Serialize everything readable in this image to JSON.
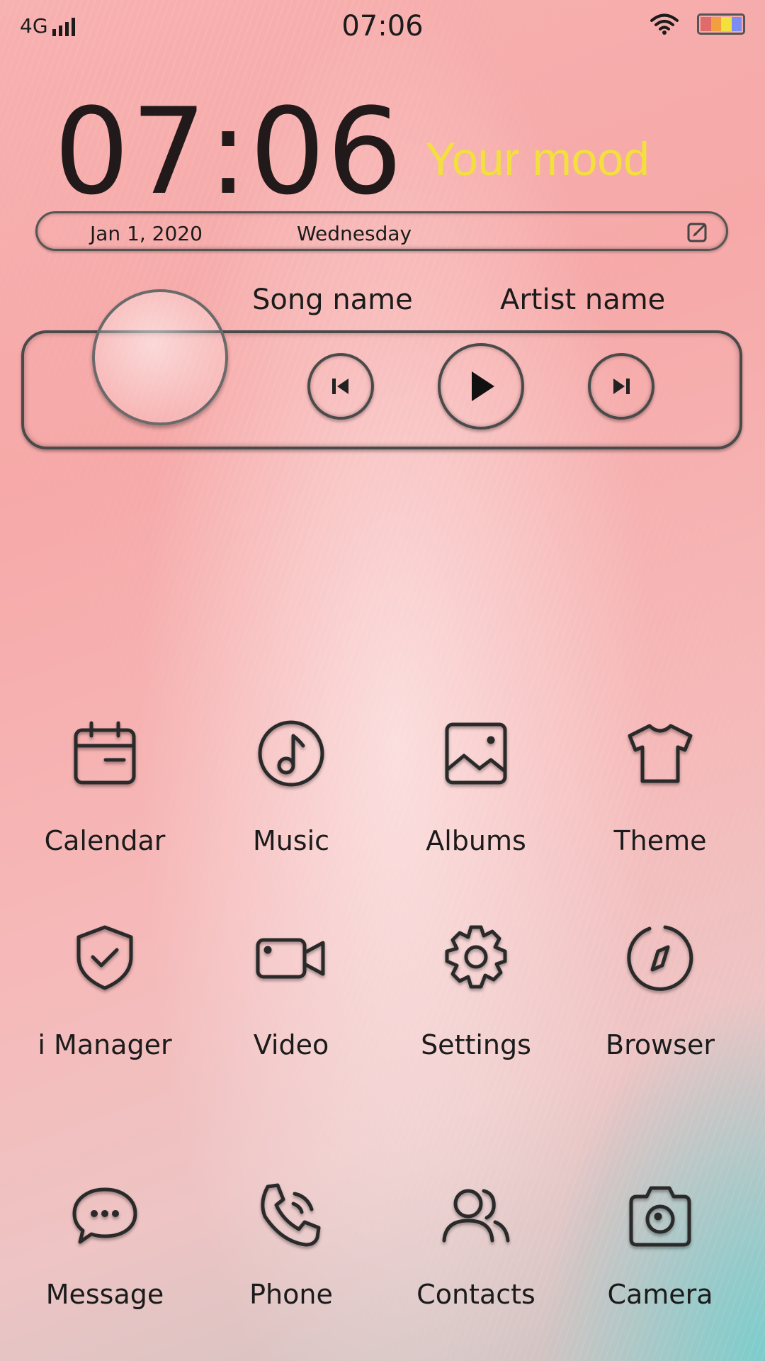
{
  "status_bar": {
    "network": "4G",
    "time": "07:06",
    "battery_colors": [
      "#e06b6b",
      "#f0a040",
      "#f3e03c",
      "#7c8cf0"
    ]
  },
  "clock_widget": {
    "time": "07:06",
    "mood": "Your mood",
    "date": "Jan 1, 2020",
    "weekday": "Wednesday"
  },
  "music_widget": {
    "song_name": "Song name",
    "artist_name": "Artist name",
    "state": "paused"
  },
  "apps": [
    {
      "label": "Calendar",
      "icon": "calendar-icon"
    },
    {
      "label": "Music",
      "icon": "music-icon"
    },
    {
      "label": "Albums",
      "icon": "albums-icon"
    },
    {
      "label": "Theme",
      "icon": "theme-icon"
    },
    {
      "label": "i Manager",
      "icon": "shield-icon"
    },
    {
      "label": "Video",
      "icon": "video-icon"
    },
    {
      "label": "Settings",
      "icon": "gear-icon"
    },
    {
      "label": "Browser",
      "icon": "compass-icon"
    },
    {
      "label": "Message",
      "icon": "message-icon"
    },
    {
      "label": "Phone",
      "icon": "phone-icon"
    },
    {
      "label": "Contacts",
      "icon": "contacts-icon"
    },
    {
      "label": "Camera",
      "icon": "camera-icon"
    }
  ],
  "colors": {
    "mood_text": "#f3e03c",
    "outline": "#3a3a3a"
  }
}
